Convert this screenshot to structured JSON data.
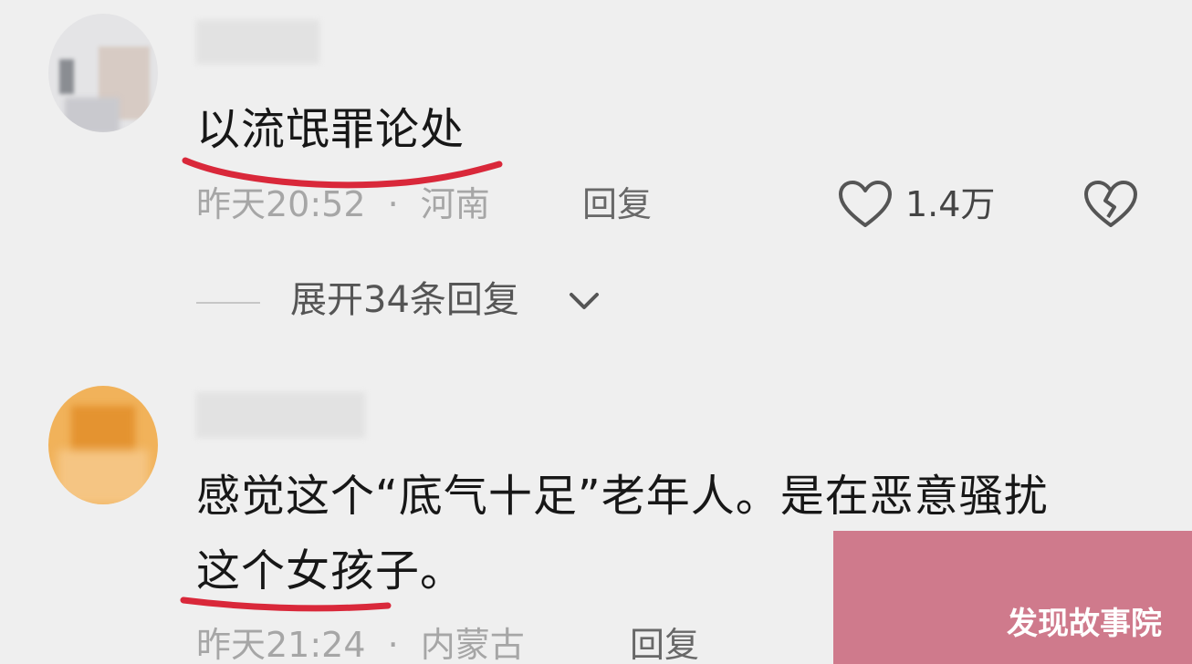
{
  "comments": [
    {
      "text": "以流氓罪论处",
      "time": "昨天20:52",
      "separator": "·",
      "location": "河南",
      "reply_label": "回复",
      "like_count": "1.4万",
      "expand_label": "展开34条回复"
    },
    {
      "text_line1": "感觉这个“底气十足”老年人。是在恶意骚扰",
      "text_line2": "这个女孩子。",
      "time": "昨天21:24",
      "separator": "·",
      "location": "内蒙古",
      "reply_label": "回复"
    }
  ],
  "watermark": "发现故事院",
  "colors": {
    "background": "#efefef",
    "underline": "#d9283a",
    "watermark_bg": "#cf7a8c"
  },
  "icons": {
    "like": "heart-outline-icon",
    "dislike": "broken-heart-icon",
    "expand": "chevron-down-icon"
  }
}
